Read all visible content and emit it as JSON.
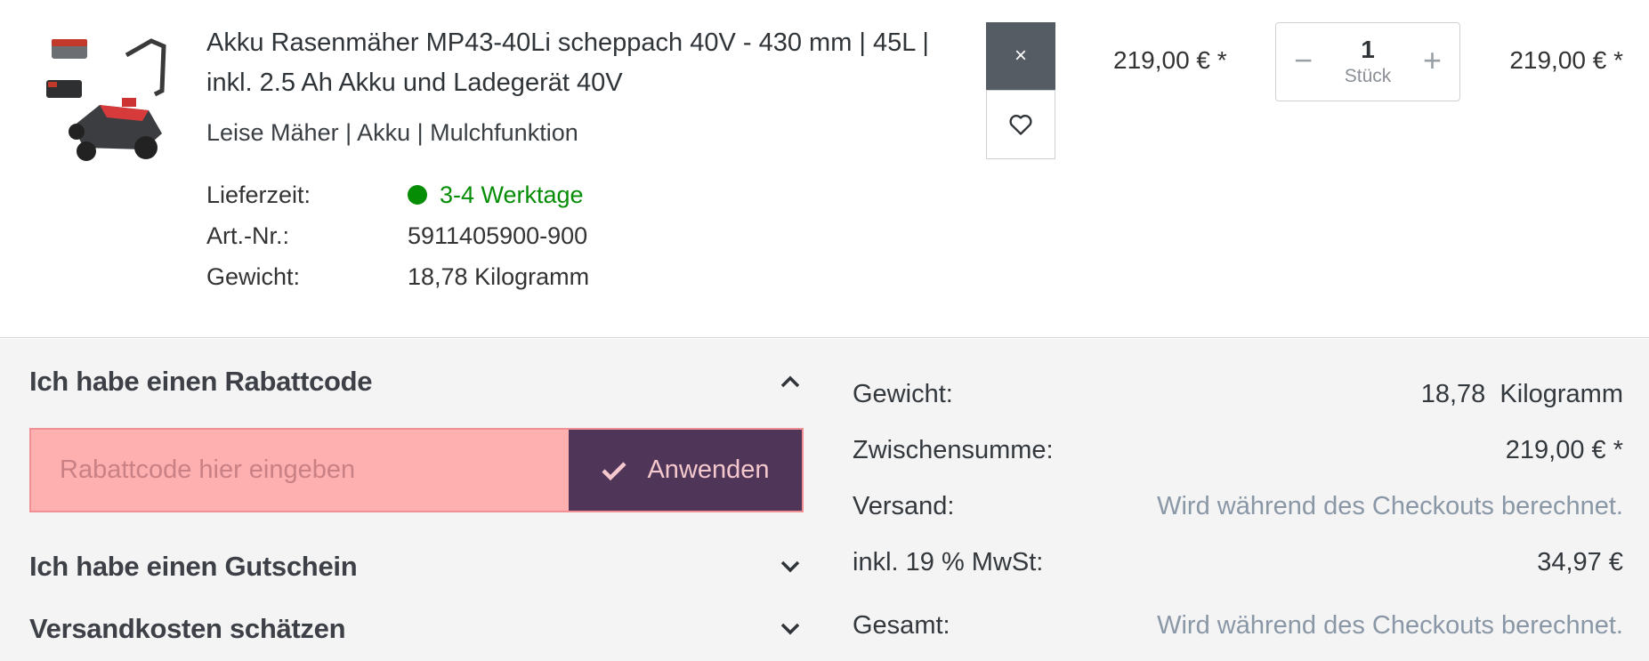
{
  "item": {
    "title": "Akku Rasenmäher MP43-40Li scheppach 40V - 430 mm | 45L | inkl. 2.5 Ah Akku und Ladegerät 40V",
    "subtitle": "Leise Mäher | Akku | Mulchfunktion",
    "delivery_label": "Lieferzeit:",
    "delivery_value": "3-4 Werktage",
    "artnr_label": "Art.-Nr.:",
    "artnr_value": "5911405900-900",
    "weight_label": "Gewicht:",
    "weight_value": "18,78 Kilogramm",
    "remove_icon": "×",
    "unit_price": "219,00 € *",
    "quantity": "1",
    "quantity_unit": "Stück",
    "line_total": "219,00 € *",
    "status_color": "#068d06"
  },
  "promo": {
    "coupon_title": "Ich habe einen Rabattcode",
    "coupon_placeholder": "Rabattcode hier eingeben",
    "apply_label": "Anwenden",
    "voucher_title": "Ich habe einen Gutschein",
    "shipping_title": "Versandkosten schätzen"
  },
  "summary": {
    "weight_label": "Gewicht:",
    "weight_value": "18,78  Kilogramm",
    "subtotal_label": "Zwischensumme:",
    "subtotal_value": "219,00 € *",
    "shipping_label": "Versand:",
    "shipping_value": "Wird während des Checkouts berechnet.",
    "vat_label": "inkl. 19 % MwSt:",
    "vat_value": "34,97 €",
    "total_label": "Gesamt:",
    "total_value": "Wird während des Checkouts berechnet."
  },
  "colors": {
    "accent_button": "#4f3558",
    "coupon_field": "#feb0b0",
    "remove_button": "#555c63"
  }
}
